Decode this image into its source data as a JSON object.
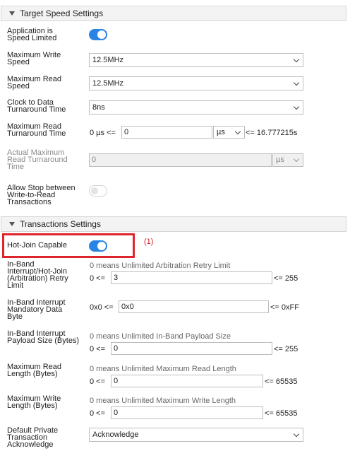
{
  "sections": {
    "target_speed": "Target Speed Settings",
    "transactions": "Transactions Settings"
  },
  "rows": {
    "app_speed_limited": {
      "label": "Application is\nSpeed Limited",
      "toggle": "on"
    },
    "max_write_speed": {
      "label": "Maximum Write\nSpeed",
      "value": "12.5MHz"
    },
    "max_read_speed": {
      "label": "Maximum Read\nSpeed",
      "value": "12.5MHz"
    },
    "clock_turnaround": {
      "label": "Clock to Data\nTurnaround Time",
      "value": "8ns"
    },
    "max_read_turnaround": {
      "label": "Maximum Read\nTurnaround Time",
      "prefix": "0 µs <=",
      "value": "0",
      "unit": "µs",
      "suffix": "<= 16.777215s"
    },
    "actual_max_read_turnaround": {
      "label": "Actual Maximum\nRead Turnaround\nTime",
      "value": "0",
      "unit": "µs"
    },
    "allow_stop": {
      "label": "Allow Stop between\nWrite-to-Read\nTransactions",
      "toggle": "off"
    },
    "hot_join": {
      "label": "Hot-Join Capable",
      "toggle": "on"
    },
    "ibi_retry": {
      "label": "In-Band\nInterrupt/Hot-Join\n(Arbitration) Retry\nLimit",
      "hint": "0 means Unlimited Arbitration Retry Limit",
      "prefix": "0 <=",
      "value": "3",
      "suffix": "<= 255"
    },
    "ibi_mdb": {
      "label": "In-Band Interrupt\nMandatory Data\nByte",
      "prefix": "0x0 <=",
      "value": "0x0",
      "suffix": "<= 0xFF"
    },
    "ibi_payload": {
      "label": "In-Band Interrupt\nPayload Size (Bytes)",
      "hint": "0 means Unlimited In-Band Payload Size",
      "prefix": "0 <=",
      "value": "0",
      "suffix": "<= 255"
    },
    "max_read_len": {
      "label": "Maximum Read\nLength (Bytes)",
      "hint": "0 means Unlimited Maximum Read Length",
      "prefix": "0 <=",
      "value": "0",
      "suffix": "<= 65535"
    },
    "max_write_len": {
      "label": "Maximum Write\nLength (Bytes)",
      "hint": "0 means Unlimited Maximum Write Length",
      "prefix": "0 <=",
      "value": "0",
      "suffix": "<= 65535"
    },
    "default_private_ack": {
      "label": "Default Private\nTransaction\nAcknowledge",
      "value": "Acknowledge"
    }
  },
  "annotation": "(1)",
  "colors": {
    "toggle_on": "#2a84e6",
    "highlight": "#e0242b"
  }
}
